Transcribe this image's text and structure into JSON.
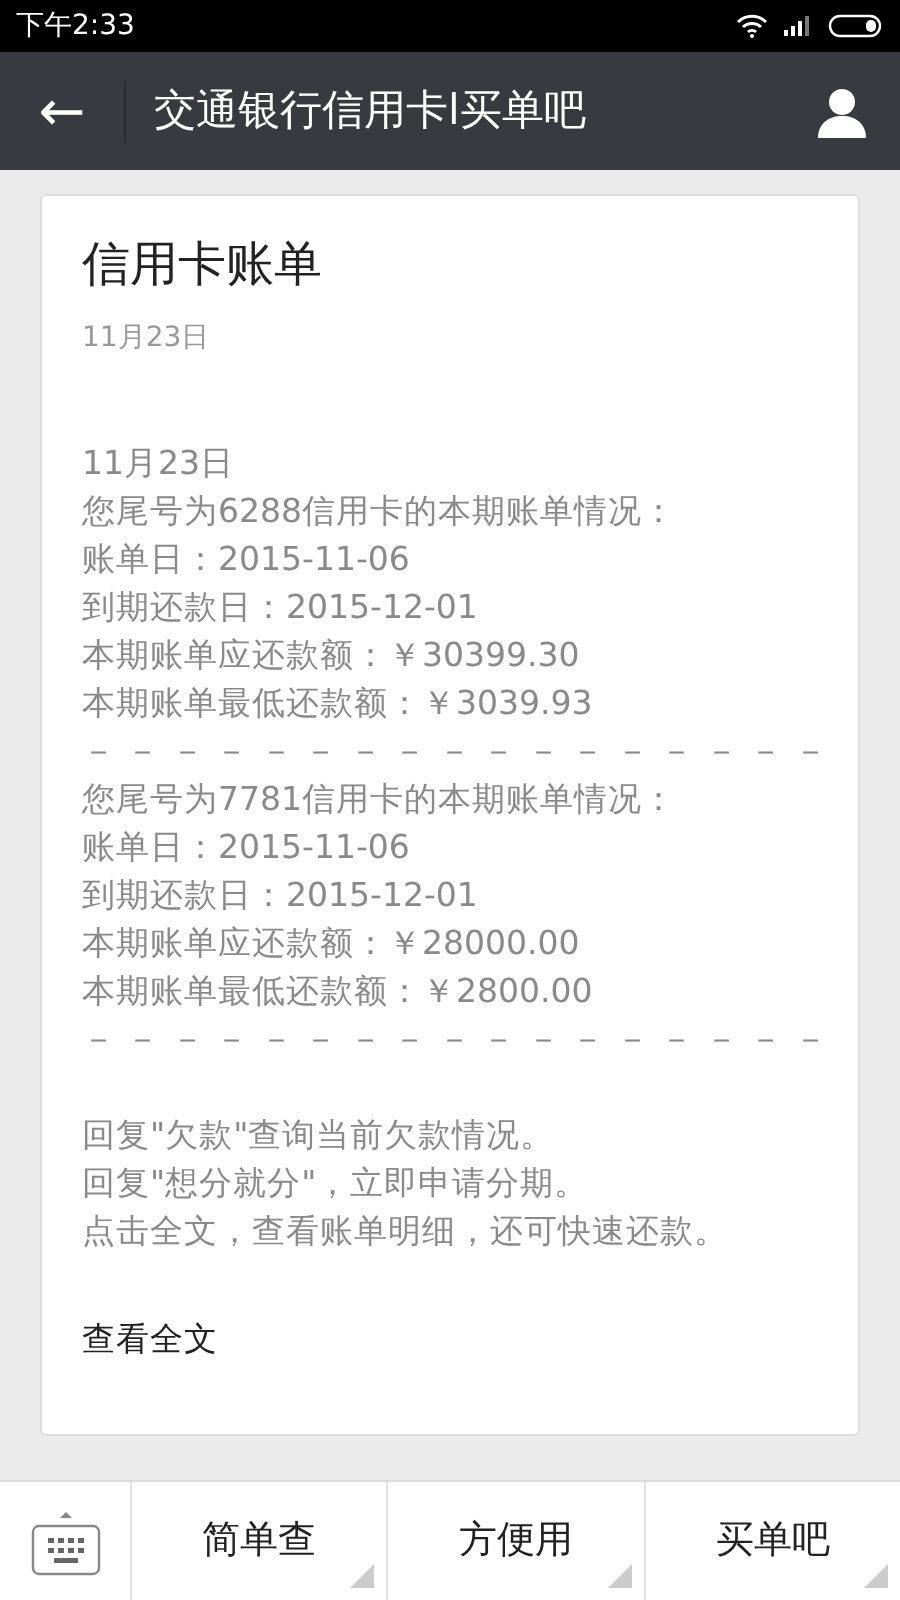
{
  "status_bar": {
    "time": "下午2:33"
  },
  "header": {
    "back": "←",
    "title": "交通银行信用卡l买单吧"
  },
  "card": {
    "title": "信用卡账单",
    "date": "11月23日",
    "blocks": [
      {
        "lines": [
          "11月23日",
          "您尾号为6288信用卡的本期账单情况：",
          "账单日：2015-11-06",
          "到期还款日：2015-12-01",
          "本期账单应还款额：￥30399.30",
          "本期账单最低还款额：￥3039.93",
          "－ － － － － － － － － － － － － － － － －",
          "您尾号为7781信用卡的本期账单情况：",
          "账单日：2015-11-06",
          "到期还款日：2015-12-01",
          "本期账单应还款额：￥28000.00",
          "本期账单最低还款额：￥2800.00",
          "－ － － － － － － － － － － － － － － － －"
        ]
      },
      {
        "lines": [
          "回复\"欠款\"查询当前欠款情况。",
          "回复\"想分就分\"，立即申请分期。",
          "点击全文，查看账单明细，还可快速还款。"
        ]
      }
    ],
    "link": "查看全文"
  },
  "menu": [
    {
      "label": "简单查"
    },
    {
      "label": "方便用"
    },
    {
      "label": "买单吧"
    }
  ]
}
